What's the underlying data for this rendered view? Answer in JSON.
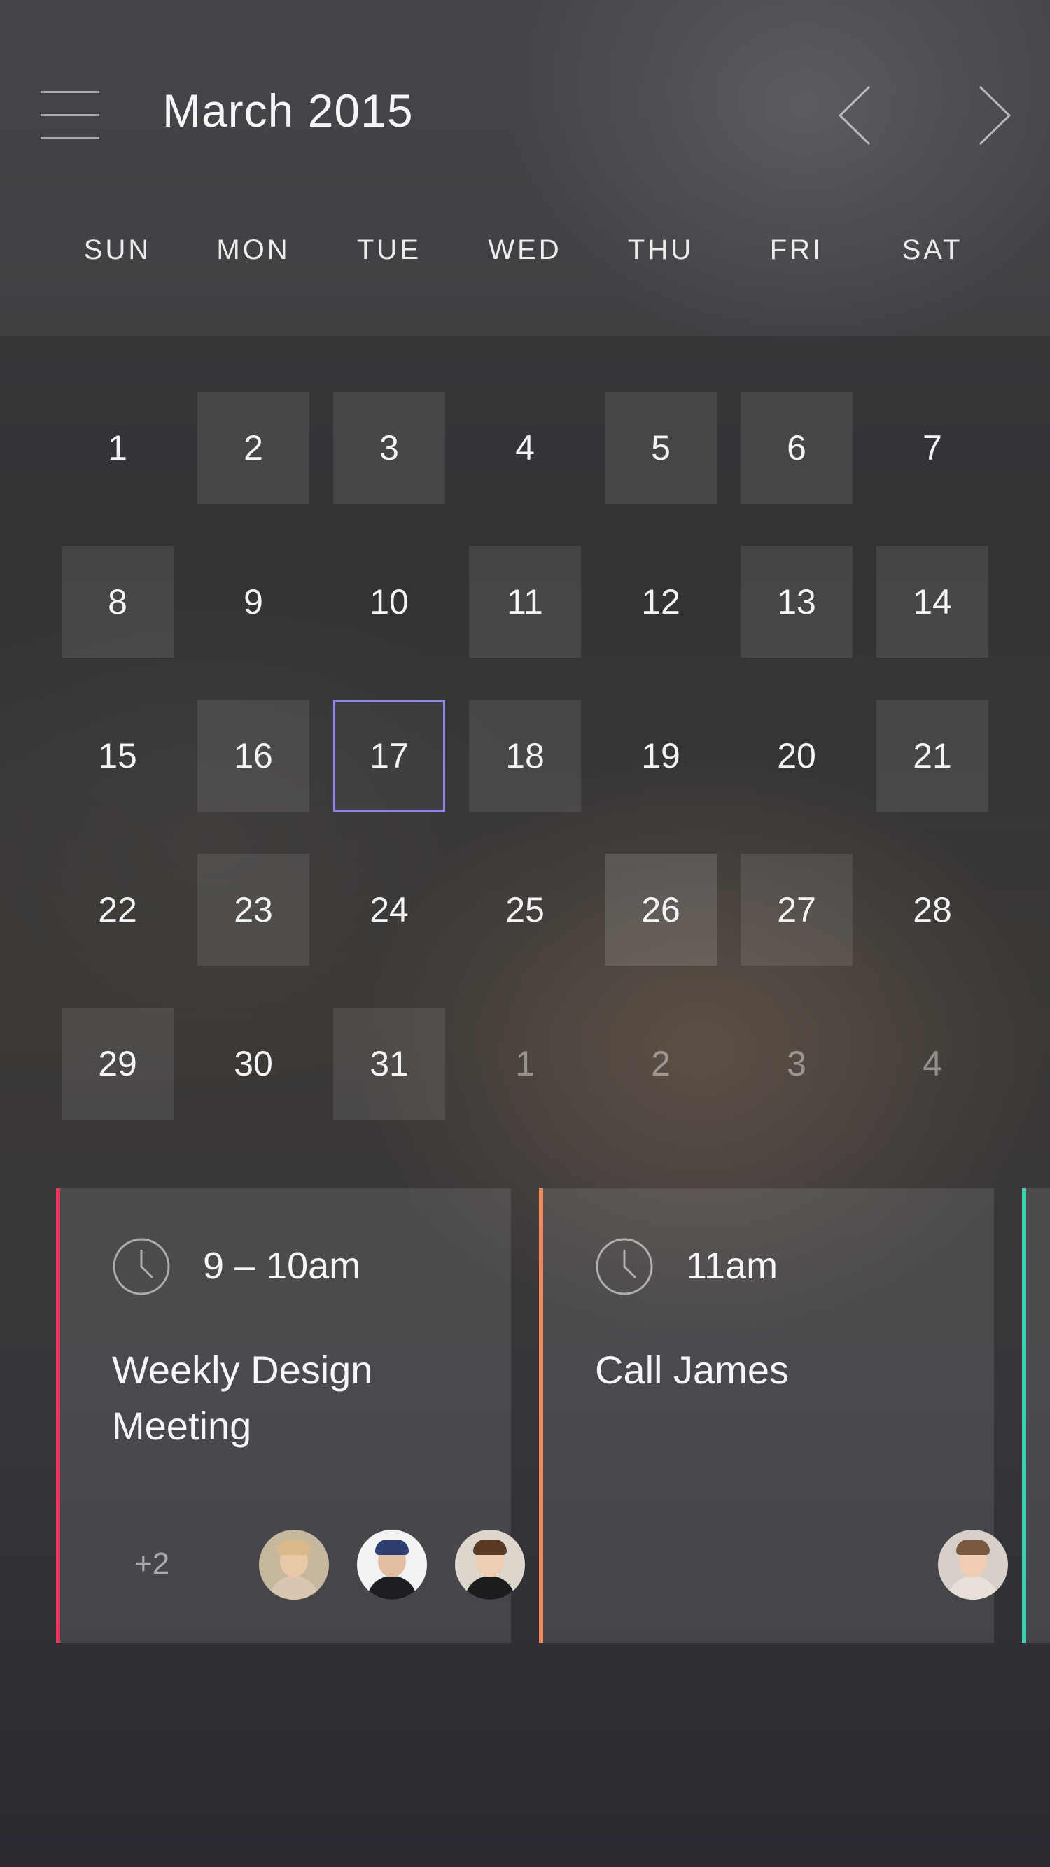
{
  "header": {
    "menu_icon": "hamburger-menu-icon",
    "title": "March 2015",
    "prev_icon": "chevron-left-icon",
    "next_icon": "chevron-right-icon"
  },
  "weekdays": [
    "SUN",
    "MON",
    "TUE",
    "WED",
    "THU",
    "FRI",
    "SAT"
  ],
  "weeks": [
    [
      {
        "label": "1",
        "event": false
      },
      {
        "label": "2",
        "event": true
      },
      {
        "label": "3",
        "event": true
      },
      {
        "label": "4",
        "event": false
      },
      {
        "label": "5",
        "event": true
      },
      {
        "label": "6",
        "event": true
      },
      {
        "label": "7",
        "event": false
      }
    ],
    [
      {
        "label": "8",
        "event": true
      },
      {
        "label": "9",
        "event": false
      },
      {
        "label": "10",
        "event": false
      },
      {
        "label": "11",
        "event": true
      },
      {
        "label": "12",
        "event": false
      },
      {
        "label": "13",
        "event": true
      },
      {
        "label": "14",
        "event": true
      }
    ],
    [
      {
        "label": "15",
        "event": false
      },
      {
        "label": "16",
        "event": true
      },
      {
        "label": "17",
        "event": false,
        "selected": true
      },
      {
        "label": "18",
        "event": true
      },
      {
        "label": "19",
        "event": false
      },
      {
        "label": "20",
        "event": false
      },
      {
        "label": "21",
        "event": true
      }
    ],
    [
      {
        "label": "22",
        "event": false
      },
      {
        "label": "23",
        "event": true
      },
      {
        "label": "24",
        "event": false
      },
      {
        "label": "25",
        "event": false
      },
      {
        "label": "26",
        "event": true,
        "strong": true
      },
      {
        "label": "27",
        "event": true
      },
      {
        "label": "28",
        "event": false
      }
    ],
    [
      {
        "label": "29",
        "event": true
      },
      {
        "label": "30",
        "event": false
      },
      {
        "label": "31",
        "event": true
      },
      {
        "label": "1",
        "event": false,
        "muted": true
      },
      {
        "label": "2",
        "event": false,
        "muted": true
      },
      {
        "label": "3",
        "event": false,
        "muted": true
      },
      {
        "label": "4",
        "event": false,
        "muted": true
      }
    ]
  ],
  "events": [
    {
      "time": "9 – 10am",
      "title": "Weekly Design Meeting",
      "accent": "#e8365e",
      "more": "+2",
      "attendees": [
        {
          "skin": "#e9c8a8",
          "hair": "#d9b98a",
          "shirt": "#d8c6b0",
          "bg": "#c7b79f"
        },
        {
          "skin": "#e2bfa2",
          "hair": "#2e3e6e",
          "shirt": "#1e1e22",
          "bg": "#f2f2f2"
        },
        {
          "skin": "#efcdb3",
          "hair": "#5a3a24",
          "shirt": "#1c1c1e",
          "bg": "#dcd6cc"
        }
      ]
    },
    {
      "time": "11am",
      "title": "Call James",
      "accent": "#f08a5d",
      "more": "",
      "attendees": [
        {
          "skin": "#f0cdb2",
          "hair": "#7a5a3e",
          "shirt": "#e6e0d8",
          "bg": "#d6d0c8"
        }
      ]
    },
    {
      "time": "",
      "title": "",
      "accent": "#3ecfb4",
      "more": "",
      "attendees": []
    }
  ],
  "colors": {
    "selected_border": "#8f86e6"
  }
}
